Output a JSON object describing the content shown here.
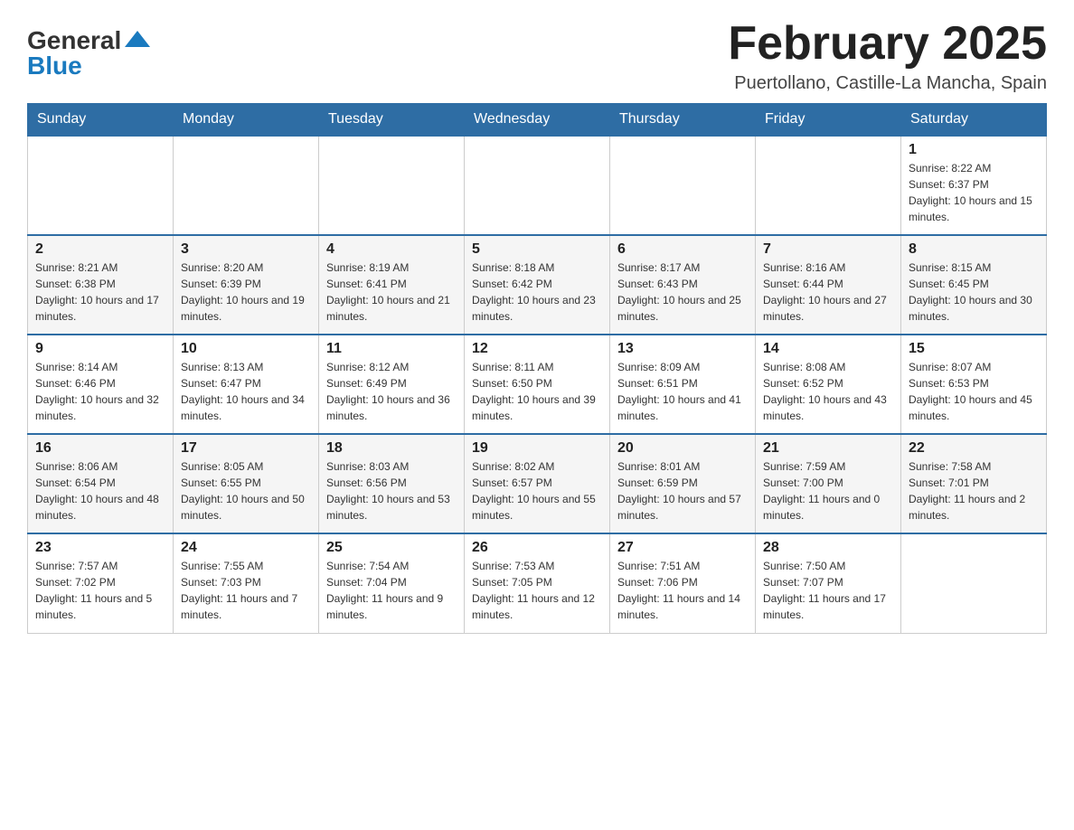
{
  "header": {
    "logo_general": "General",
    "logo_blue": "Blue",
    "title": "February 2025",
    "subtitle": "Puertollano, Castille-La Mancha, Spain"
  },
  "weekdays": [
    "Sunday",
    "Monday",
    "Tuesday",
    "Wednesday",
    "Thursday",
    "Friday",
    "Saturday"
  ],
  "weeks": [
    [
      {
        "day": "",
        "sunrise": "",
        "sunset": "",
        "daylight": ""
      },
      {
        "day": "",
        "sunrise": "",
        "sunset": "",
        "daylight": ""
      },
      {
        "day": "",
        "sunrise": "",
        "sunset": "",
        "daylight": ""
      },
      {
        "day": "",
        "sunrise": "",
        "sunset": "",
        "daylight": ""
      },
      {
        "day": "",
        "sunrise": "",
        "sunset": "",
        "daylight": ""
      },
      {
        "day": "",
        "sunrise": "",
        "sunset": "",
        "daylight": ""
      },
      {
        "day": "1",
        "sunrise": "Sunrise: 8:22 AM",
        "sunset": "Sunset: 6:37 PM",
        "daylight": "Daylight: 10 hours and 15 minutes."
      }
    ],
    [
      {
        "day": "2",
        "sunrise": "Sunrise: 8:21 AM",
        "sunset": "Sunset: 6:38 PM",
        "daylight": "Daylight: 10 hours and 17 minutes."
      },
      {
        "day": "3",
        "sunrise": "Sunrise: 8:20 AM",
        "sunset": "Sunset: 6:39 PM",
        "daylight": "Daylight: 10 hours and 19 minutes."
      },
      {
        "day": "4",
        "sunrise": "Sunrise: 8:19 AM",
        "sunset": "Sunset: 6:41 PM",
        "daylight": "Daylight: 10 hours and 21 minutes."
      },
      {
        "day": "5",
        "sunrise": "Sunrise: 8:18 AM",
        "sunset": "Sunset: 6:42 PM",
        "daylight": "Daylight: 10 hours and 23 minutes."
      },
      {
        "day": "6",
        "sunrise": "Sunrise: 8:17 AM",
        "sunset": "Sunset: 6:43 PM",
        "daylight": "Daylight: 10 hours and 25 minutes."
      },
      {
        "day": "7",
        "sunrise": "Sunrise: 8:16 AM",
        "sunset": "Sunset: 6:44 PM",
        "daylight": "Daylight: 10 hours and 27 minutes."
      },
      {
        "day": "8",
        "sunrise": "Sunrise: 8:15 AM",
        "sunset": "Sunset: 6:45 PM",
        "daylight": "Daylight: 10 hours and 30 minutes."
      }
    ],
    [
      {
        "day": "9",
        "sunrise": "Sunrise: 8:14 AM",
        "sunset": "Sunset: 6:46 PM",
        "daylight": "Daylight: 10 hours and 32 minutes."
      },
      {
        "day": "10",
        "sunrise": "Sunrise: 8:13 AM",
        "sunset": "Sunset: 6:47 PM",
        "daylight": "Daylight: 10 hours and 34 minutes."
      },
      {
        "day": "11",
        "sunrise": "Sunrise: 8:12 AM",
        "sunset": "Sunset: 6:49 PM",
        "daylight": "Daylight: 10 hours and 36 minutes."
      },
      {
        "day": "12",
        "sunrise": "Sunrise: 8:11 AM",
        "sunset": "Sunset: 6:50 PM",
        "daylight": "Daylight: 10 hours and 39 minutes."
      },
      {
        "day": "13",
        "sunrise": "Sunrise: 8:09 AM",
        "sunset": "Sunset: 6:51 PM",
        "daylight": "Daylight: 10 hours and 41 minutes."
      },
      {
        "day": "14",
        "sunrise": "Sunrise: 8:08 AM",
        "sunset": "Sunset: 6:52 PM",
        "daylight": "Daylight: 10 hours and 43 minutes."
      },
      {
        "day": "15",
        "sunrise": "Sunrise: 8:07 AM",
        "sunset": "Sunset: 6:53 PM",
        "daylight": "Daylight: 10 hours and 45 minutes."
      }
    ],
    [
      {
        "day": "16",
        "sunrise": "Sunrise: 8:06 AM",
        "sunset": "Sunset: 6:54 PM",
        "daylight": "Daylight: 10 hours and 48 minutes."
      },
      {
        "day": "17",
        "sunrise": "Sunrise: 8:05 AM",
        "sunset": "Sunset: 6:55 PM",
        "daylight": "Daylight: 10 hours and 50 minutes."
      },
      {
        "day": "18",
        "sunrise": "Sunrise: 8:03 AM",
        "sunset": "Sunset: 6:56 PM",
        "daylight": "Daylight: 10 hours and 53 minutes."
      },
      {
        "day": "19",
        "sunrise": "Sunrise: 8:02 AM",
        "sunset": "Sunset: 6:57 PM",
        "daylight": "Daylight: 10 hours and 55 minutes."
      },
      {
        "day": "20",
        "sunrise": "Sunrise: 8:01 AM",
        "sunset": "Sunset: 6:59 PM",
        "daylight": "Daylight: 10 hours and 57 minutes."
      },
      {
        "day": "21",
        "sunrise": "Sunrise: 7:59 AM",
        "sunset": "Sunset: 7:00 PM",
        "daylight": "Daylight: 11 hours and 0 minutes."
      },
      {
        "day": "22",
        "sunrise": "Sunrise: 7:58 AM",
        "sunset": "Sunset: 7:01 PM",
        "daylight": "Daylight: 11 hours and 2 minutes."
      }
    ],
    [
      {
        "day": "23",
        "sunrise": "Sunrise: 7:57 AM",
        "sunset": "Sunset: 7:02 PM",
        "daylight": "Daylight: 11 hours and 5 minutes."
      },
      {
        "day": "24",
        "sunrise": "Sunrise: 7:55 AM",
        "sunset": "Sunset: 7:03 PM",
        "daylight": "Daylight: 11 hours and 7 minutes."
      },
      {
        "day": "25",
        "sunrise": "Sunrise: 7:54 AM",
        "sunset": "Sunset: 7:04 PM",
        "daylight": "Daylight: 11 hours and 9 minutes."
      },
      {
        "day": "26",
        "sunrise": "Sunrise: 7:53 AM",
        "sunset": "Sunset: 7:05 PM",
        "daylight": "Daylight: 11 hours and 12 minutes."
      },
      {
        "day": "27",
        "sunrise": "Sunrise: 7:51 AM",
        "sunset": "Sunset: 7:06 PM",
        "daylight": "Daylight: 11 hours and 14 minutes."
      },
      {
        "day": "28",
        "sunrise": "Sunrise: 7:50 AM",
        "sunset": "Sunset: 7:07 PM",
        "daylight": "Daylight: 11 hours and 17 minutes."
      },
      {
        "day": "",
        "sunrise": "",
        "sunset": "",
        "daylight": ""
      }
    ]
  ]
}
